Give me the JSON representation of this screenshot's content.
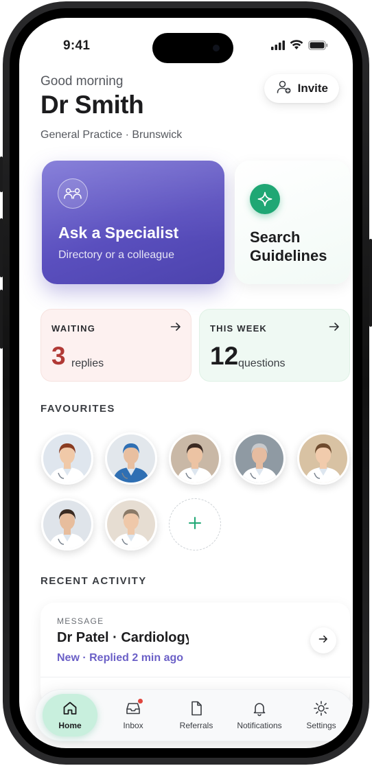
{
  "status_bar": {
    "time": "9:41"
  },
  "header": {
    "greeting": "Good morning",
    "doctor_name": "Dr Smith",
    "practice": "General Practice · Brunswick",
    "invite_label": "Invite"
  },
  "actions": {
    "ask": {
      "title": "Ask a Specialist",
      "subtitle": "Directory or a colleague",
      "color": "#5a4fbe"
    },
    "guidelines": {
      "title": "Search Guidelines",
      "icon_color": "#1fa774"
    }
  },
  "stats": {
    "waiting": {
      "label": "WAITING",
      "value": "3",
      "unit": "replies",
      "color": "#b13a36"
    },
    "this_week": {
      "label": "THIS WEEK",
      "value": "12",
      "unit": "questions"
    }
  },
  "favourites": {
    "label": "FAVOURITES",
    "avatars": [
      {
        "icon": "doctor-avatar",
        "skin": "#f0c9a8",
        "hair": "#8a3c22",
        "coat": "#ffffff",
        "bg": "#dfe6ee"
      },
      {
        "icon": "doctor-avatar",
        "skin": "#e8bfa0",
        "hair": "#2f6fb3",
        "coat": "#2f6fb3",
        "bg": "#e2e7ec"
      },
      {
        "icon": "doctor-avatar",
        "skin": "#ecc3a3",
        "hair": "#3b2a22",
        "coat": "#ffffff",
        "bg": "#c9b8a6"
      },
      {
        "icon": "doctor-avatar",
        "skin": "#e6bca0",
        "hair": "#c7c9cc",
        "coat": "#ffffff",
        "bg": "#8f9aa3"
      },
      {
        "icon": "doctor-avatar",
        "skin": "#f1cbac",
        "hair": "#6e4a2d",
        "coat": "#ffffff",
        "bg": "#d8c2a3"
      },
      {
        "icon": "doctor-avatar",
        "skin": "#e7bd9d",
        "hair": "#3a2b22",
        "coat": "#ffffff",
        "bg": "#dfe4ea"
      },
      {
        "icon": "doctor-avatar",
        "skin": "#efc8a9",
        "hair": "#8a7a68",
        "coat": "#ffffff",
        "bg": "#e6ddd2"
      }
    ],
    "add_icon": "plus-icon"
  },
  "recent_activity": {
    "label": "RECENT ACTIVITY",
    "item": {
      "type": "MESSAGE",
      "title": "Dr Patel · Cardiology",
      "status": "New · Replied 2 min ago",
      "status_color": "#6b60c7"
    }
  },
  "tabbar": {
    "tabs": [
      {
        "label": "Home",
        "icon": "home-icon",
        "active": true
      },
      {
        "label": "Inbox",
        "icon": "inbox-icon",
        "badge": true
      },
      {
        "label": "Referrals",
        "icon": "document-icon"
      },
      {
        "label": "Notifications",
        "icon": "bell-icon"
      },
      {
        "label": "Settings",
        "icon": "gear-icon"
      }
    ]
  }
}
